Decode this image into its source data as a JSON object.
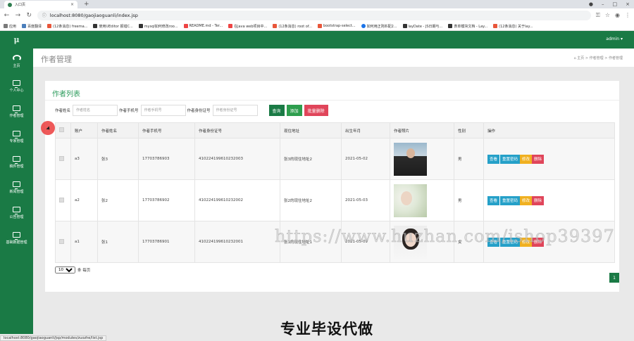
{
  "browser": {
    "tab_title": "入口页",
    "url": "localhost:8080/gaojiaoguanli/index.jsp",
    "bookmarks": [
      "应用",
      "百度翻译",
      "(12条消息) freema...",
      "使用UEditor 报错C...",
      "mysql如何修改roo...",
      "README.md - Ter...",
      "在java web项目中...",
      "(12条消息) root of...",
      "bootstrap-select...",
      "如何用正则匹配2...",
      "layDate - JS日期与...",
      "表单模块文档 - Lay...",
      "(12条消息) 关于lay..."
    ],
    "status_url": "localhost:8080/gaojiaoguanli/jsp/modules/zuozhe/list.jsp"
  },
  "app": {
    "logo": "μ",
    "user": "admin ▾",
    "sidebar": [
      {
        "label": "主页",
        "icon": "dashboard-icon"
      },
      {
        "label": "个人中心",
        "icon": "monitor-icon"
      },
      {
        "label": "作者管理",
        "icon": "monitor-icon"
      },
      {
        "label": "专家管理",
        "icon": "monitor-icon"
      },
      {
        "label": "稿件管理",
        "icon": "monitor-icon"
      },
      {
        "label": "新闻管理",
        "icon": "monitor-icon"
      },
      {
        "label": "公告管理",
        "icon": "monitor-icon"
      },
      {
        "label": "基础数据管理",
        "icon": "monitor-icon"
      }
    ],
    "page_title": "作者管理",
    "breadcrumb": "⌂ 主页  >  作者管理  >  作者管理"
  },
  "panel": {
    "title": "作者列表",
    "search": {
      "name_label": "作者姓名",
      "name_placeholder": "作者姓名",
      "phone_label": "作者手机号",
      "phone_placeholder": "作者手机号",
      "id_label": "作者身份证号",
      "id_placeholder": "作者身份证号",
      "query": "查询",
      "add": "添加",
      "batch_delete": "批量删除"
    },
    "columns": [
      "账户",
      "作者姓名",
      "作者手机号",
      "作者身份证号",
      "现住地址",
      "出生年月",
      "作者照片",
      "性别",
      "操作"
    ],
    "rows": [
      {
        "account": "a3",
        "name": "张3",
        "phone": "17703786903",
        "idcard": "410224199610232003",
        "address": "张3的现住地址2",
        "birth": "2021-05-02",
        "gender": "男"
      },
      {
        "account": "a2",
        "name": "张2",
        "phone": "17703786902",
        "idcard": "410224199610232002",
        "address": "张2的现住地址2",
        "birth": "2021-05-03",
        "gender": "男"
      },
      {
        "account": "a1",
        "name": "张1",
        "phone": "17703786901",
        "idcard": "410224199610232001",
        "address": "张1的现住地址1",
        "birth": "2021-05-09",
        "gender": "女"
      }
    ],
    "ops": {
      "view": "查看",
      "reset": "重置密码",
      "edit": "修改",
      "delete": "删除"
    },
    "pager": {
      "size": "10",
      "suffix": "条 每页",
      "page": "1"
    }
  },
  "watermark": "https://www.huzhan.com/ishop39397",
  "caption": "专业毕设代做"
}
